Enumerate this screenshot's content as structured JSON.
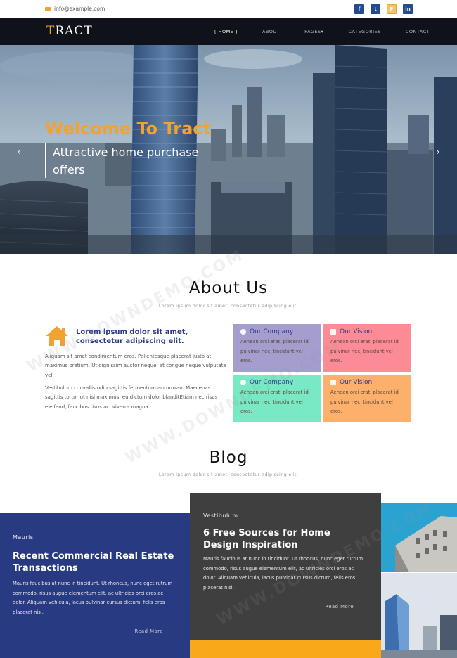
{
  "topbar": {
    "email": "info@example.com",
    "social": [
      {
        "icon": "facebook-icon",
        "glyph": "f"
      },
      {
        "icon": "twitter-icon",
        "glyph": "t"
      },
      {
        "icon": "dribbble-icon",
        "glyph": "P"
      },
      {
        "icon": "linkedin-icon",
        "glyph": "in"
      }
    ]
  },
  "nav": {
    "logo_first": "T",
    "logo_rest": "RACT",
    "items": [
      "[ HOME ]",
      "ABOUT",
      "PAGES▾",
      "CATEGORIES",
      "CONTACT"
    ],
    "active_index": 0
  },
  "hero": {
    "title": "Welcome To Tract",
    "subtitle": "Attractive home purchase offers",
    "prev": "‹",
    "next": "›"
  },
  "about": {
    "title": "About Us",
    "subtitle": "Lorem ipsum dolor sit amet, consectetur adipiscing elit.",
    "heading": "Lorem ipsum dolor sit amet, consectetur adipiscing elit.",
    "para1": "Aliquam sit amet condimentum eros. Pellentesque placerat justo at maximus pretium. Ut dignissim auctor neque, at congue neque vulputate vel.",
    "para2": "Vestibulum convallis odio sagittis fermentum accumsan. Maecenas sagittis tortor ut nisi maximus, eu dictum dolor blanditEtiam nec risus eleifend, faucibus risus ac, viverra magna.",
    "boxes": [
      {
        "title": "Our Company",
        "text": "Aenean orci erat, placerat id pulvinar nec, tincidunt vel eros.",
        "icon": "gear-icon"
      },
      {
        "title": "Our Vision",
        "text": "Aenean orci erat, placerat id pulvinar nec, tincidunt vel eros.",
        "icon": "document-icon"
      },
      {
        "title": "Our Company",
        "text": "Aenean orci erat, placerat id pulvinar nec, tincidunt vel eros.",
        "icon": "cloud-icon"
      },
      {
        "title": "Our Vision",
        "text": "Aenean orci erat, placerat id pulvinar nec, tincidunt vel eros.",
        "icon": "calendar-icon"
      }
    ]
  },
  "blog": {
    "title": "Blog",
    "subtitle": "Lorem ipsum dolor sit amet, consectetur adipiscing elit.",
    "cards": [
      {
        "kicker": "Mauris",
        "title": "Recent Commercial Real Estate Transactions",
        "body": "Mauris faucibus at nunc in tincidunt. Ut rhoncus, nunc eget rutrum commodo, risus augue elementum elit, ac ultricies orci eros ac dolor. Aliquam vehicula, lacus pulvinar cursus dictum, felis eros placerat nisi.",
        "more": "Read More"
      },
      {
        "kicker": "Vestibulum",
        "title": "6 Free Sources for Home Design Inspiration",
        "body": "Mauris faucibus at nunc in tincidunt. Ut rhoncus, nunc eget rutrum commodo, risus augue elementum elit, ac ultricies orci eros ac dolor. Aliquam vehicula, lacus pulvinar cursus dictum, felis eros placerat nisi.",
        "more": "Read More"
      }
    ]
  },
  "watermark": "WWW.DOWNDEMO.COM",
  "colors": {
    "accent": "#f0a330",
    "navy": "#273a82",
    "nav_bg": "#0f1218",
    "box_purple": "#a49dcd",
    "box_pink": "#fc8b95",
    "box_mint": "#79e8c5",
    "box_orange": "#fdb06b"
  }
}
